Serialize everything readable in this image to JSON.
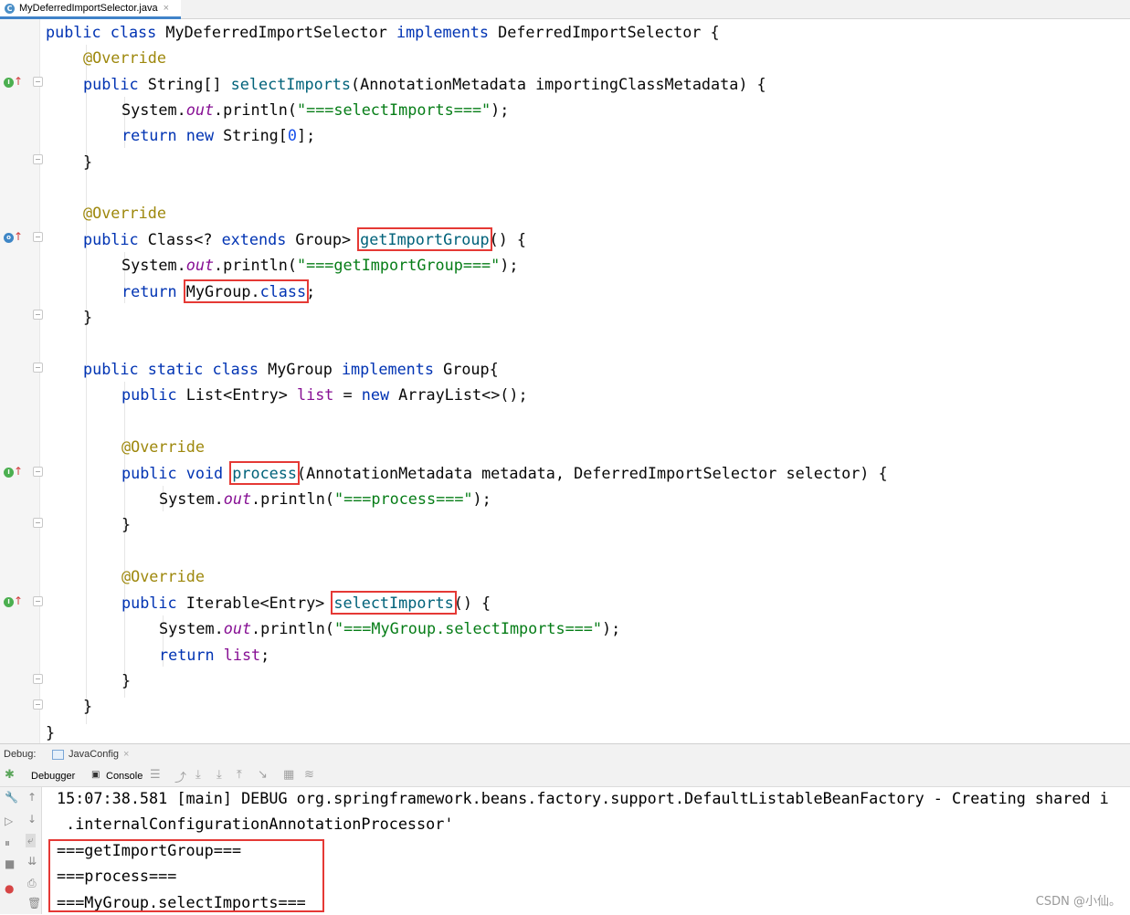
{
  "tab": {
    "icon": "C",
    "filename": "MyDeferredImportSelector.java",
    "close": "×"
  },
  "code": {
    "l1": [
      "public",
      "class",
      "MyDeferredImportSelector",
      "implements",
      "DeferredImportSelector",
      "{"
    ],
    "override": "@Override",
    "l3": [
      "public",
      "String[]",
      "selectImports",
      "(AnnotationMetadata importingClassMetadata) {"
    ],
    "sys": "System.",
    "out": "out",
    "println": ".println(",
    "str1": "\"===selectImports===\"",
    "semi_close": ");",
    "l5": [
      "return",
      "new",
      "String[",
      "0",
      "];"
    ],
    "brace": "}",
    "l9": [
      "public",
      "Class<?",
      "extends",
      "Group>",
      "getImportGroup",
      "() {"
    ],
    "str2": "\"===getImportGroup===\"",
    "l11": [
      "return",
      "MyGroup.",
      "class",
      ";"
    ],
    "l14": [
      "public",
      "static",
      "class",
      "MyGroup",
      "implements",
      "Group{"
    ],
    "l15": [
      "public",
      "List<Entry>",
      "list",
      "=",
      "new",
      "ArrayList<>();"
    ],
    "l18": [
      "public",
      "void",
      "process",
      "(AnnotationMetadata metadata, DeferredImportSelector selector) {"
    ],
    "str3": "\"===process===\"",
    "l23": [
      "public",
      "Iterable<Entry>",
      "selectImports",
      "() {"
    ],
    "str4": "\"===MyGroup.selectImports===\"",
    "l25": [
      "return",
      "list",
      ";"
    ]
  },
  "debug": {
    "label": "Debug:",
    "config": "JavaConfig",
    "close": "×",
    "tabs": [
      "Debugger",
      "Console"
    ]
  },
  "console": {
    "lines": [
      "15:07:38.581 [main] DEBUG org.springframework.beans.factory.support.DefaultListableBeanFactory - Creating shared i",
      " .internalConfigurationAnnotationProcessor'",
      "===getImportGroup===",
      "===process===",
      "===MyGroup.selectImports==="
    ]
  },
  "watermark": "CSDN @小仙。",
  "colors": {
    "keyword": "#0033b3",
    "annotation": "#9e880d",
    "string": "#067d17",
    "field": "#871094",
    "method": "#00627a",
    "highlight": "#e53935"
  }
}
